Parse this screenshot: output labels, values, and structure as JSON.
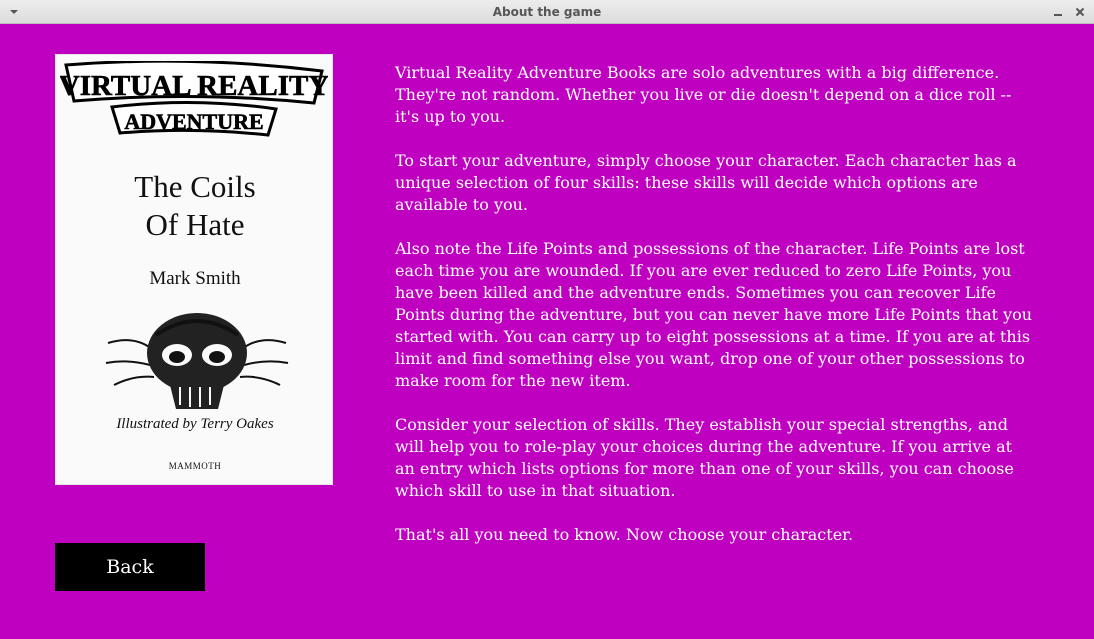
{
  "window": {
    "title": "About the game",
    "menu_icon": "chevron-down-icon",
    "minimize_icon": "minimize-icon",
    "close_icon": "close-icon"
  },
  "cover": {
    "logo_line1": "VIRTUAL REALITY",
    "logo_line2": "ADVENTURE",
    "title_line1": "The Coils",
    "title_line2": "Of Hate",
    "author": "Mark Smith",
    "illustrator": "Illustrated by Terry Oakes",
    "publisher": "MAMMOTH"
  },
  "back_button": {
    "label": "Back"
  },
  "paragraphs": [
    "Virtual Reality Adventure Books are solo adventures with a big difference. They're not random. Whether you live or die doesn't depend on a dice roll -- it's up to you.",
    "To start your adventure, simply choose your character. Each character has a unique selection of four skills: these skills will decide which options are available to you.",
    "Also note the Life Points and possessions of the character. Life Points are lost each time you are wounded. If you are ever reduced to zero Life Points, you have been killed and the adventure ends. Sometimes you can recover Life Points during the adventure, but you can never have more Life Points that you started with. You can carry up to eight possessions at a time. If you are at this limit and find something else you want, drop one of your other possessions to make room for the new item.",
    "Consider your selection of skills. They establish your special strengths, and will help you to role-play your choices during the adventure. If you arrive at an entry which lists options for more than one of your skills, you can choose which skill to use in that situation.",
    "That's all you need to know. Now choose your character."
  ],
  "colors": {
    "background": "#c000c0",
    "text": "#ffffff",
    "button_bg": "#000000"
  }
}
